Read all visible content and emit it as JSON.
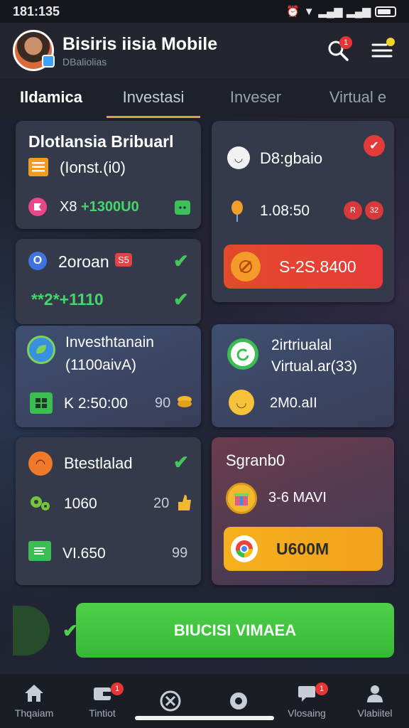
{
  "status_bar": {
    "time": "181:135"
  },
  "header": {
    "title": "Bisiris iisia Mobile",
    "subtitle": "DBaliolias",
    "search_badge": "1"
  },
  "tabs": [
    {
      "label": "Ildamica"
    },
    {
      "label": "Investasi"
    },
    {
      "label": "Inveser"
    },
    {
      "label": "Virtual e"
    }
  ],
  "cards": {
    "c1": {
      "title": "Dlotlansia Bribuarl",
      "subtitle": "(Ionst.(i0)",
      "value_prefix": "X8",
      "value": "+1300U0"
    },
    "c2": {
      "value": "2oroan",
      "tag": "S5",
      "stat": "**2*+1110"
    },
    "c3": {
      "title": "D8:gbaio",
      "amount": "1.08:50",
      "badge_a": "R",
      "badge_b": "32",
      "pill": "S-2S.8400"
    },
    "c4": {
      "title": "Investhtanain",
      "subtitle": "(1100aivA)",
      "value": "K 2:50:00",
      "side": "90"
    },
    "c5": {
      "title": "2irtriualal",
      "subtitle": "Virtual.ar(33)",
      "value": "2M0.aII"
    },
    "c6": {
      "title": "Btestlalad",
      "value": "1060",
      "side_a": "20",
      "value_b": "VI.650",
      "side_b": "99"
    },
    "c7": {
      "title": "Sgranb0",
      "value": "3-6 MAVI",
      "pill": "U600M"
    }
  },
  "cta": {
    "label": "BIUCISI VIMAEA"
  },
  "bottom_nav": [
    {
      "label": "Thqaiam",
      "icon": "home-icon",
      "badge": ""
    },
    {
      "label": "Tintiot",
      "icon": "wallet-icon",
      "badge": "1"
    },
    {
      "label": "",
      "icon": "cross-icon",
      "badge": ""
    },
    {
      "label": "",
      "icon": "gear-icon",
      "badge": ""
    },
    {
      "label": "Vlosaing",
      "icon": "chat-icon",
      "badge": "1"
    },
    {
      "label": "Vlabiitel",
      "icon": "profile-icon",
      "badge": ""
    }
  ],
  "colors": {
    "accent": "#d7a23a",
    "green": "#43d66b",
    "red": "#e63535",
    "yellow": "#f6b01d"
  }
}
